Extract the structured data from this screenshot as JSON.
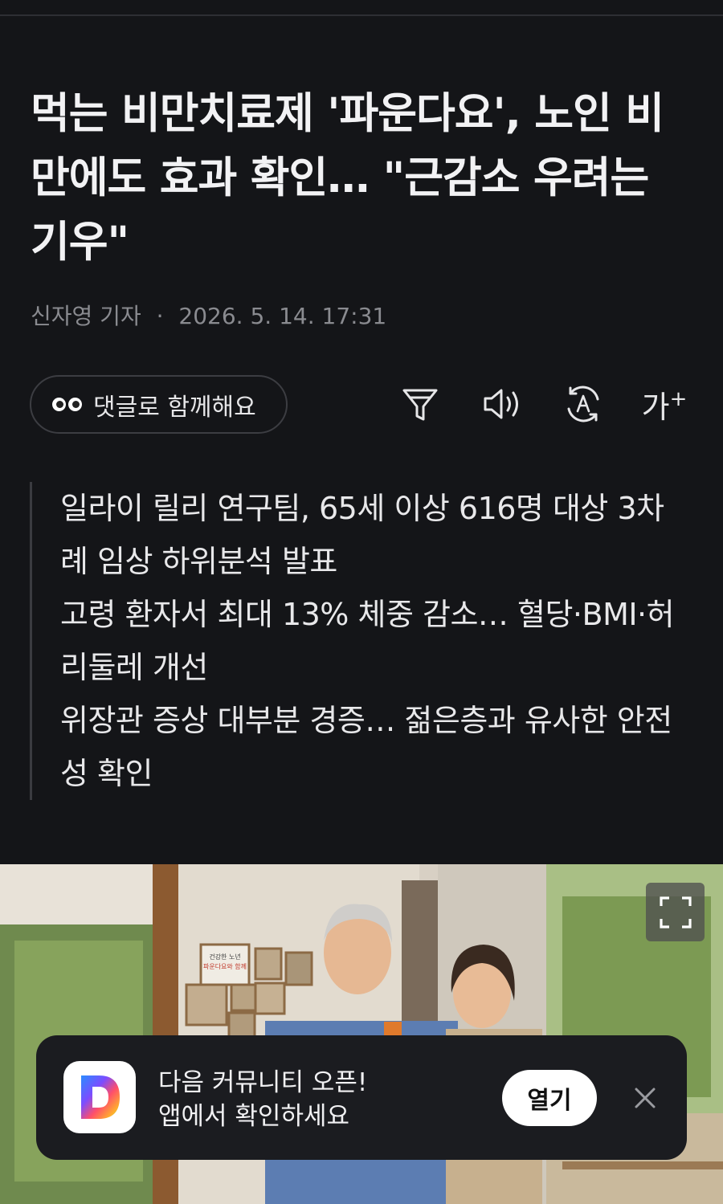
{
  "article": {
    "headline": "먹는 비만치료제 '파운다요', 노인 비만에도 효과 확인… \"근감소 우려는 기우\"",
    "reporter": "신자영 기자",
    "byline_separator": "·",
    "datetime": "2026. 5. 14. 17:31"
  },
  "toolbar": {
    "comment_label": "댓글로 함께해요",
    "font_size_label": "가",
    "font_size_plus": "+"
  },
  "summary": [
    "일라이 릴리 연구팀, 65세 이상 616명 대상 3차례 임상 하위분석 발표",
    "고령 환자서 최대 13% 체중 감소… 혈당·BMI·허리둘레 개선",
    "위장관 증상 대부분 경증… 젊은층과 유사한 안전성 확인"
  ],
  "photo": {
    "poster_line1": "건강한 노년",
    "poster_line2": "파운다요와 함께"
  },
  "app_banner": {
    "line1": "다음 커뮤니티 오픈!",
    "line2": "앱에서 확인하세요",
    "open_label": "열기",
    "icon_letter": "D"
  },
  "colors": {
    "background": "#141518",
    "banner_bg": "#1b1c20",
    "text": "#ececee",
    "muted": "#8a8b90"
  }
}
